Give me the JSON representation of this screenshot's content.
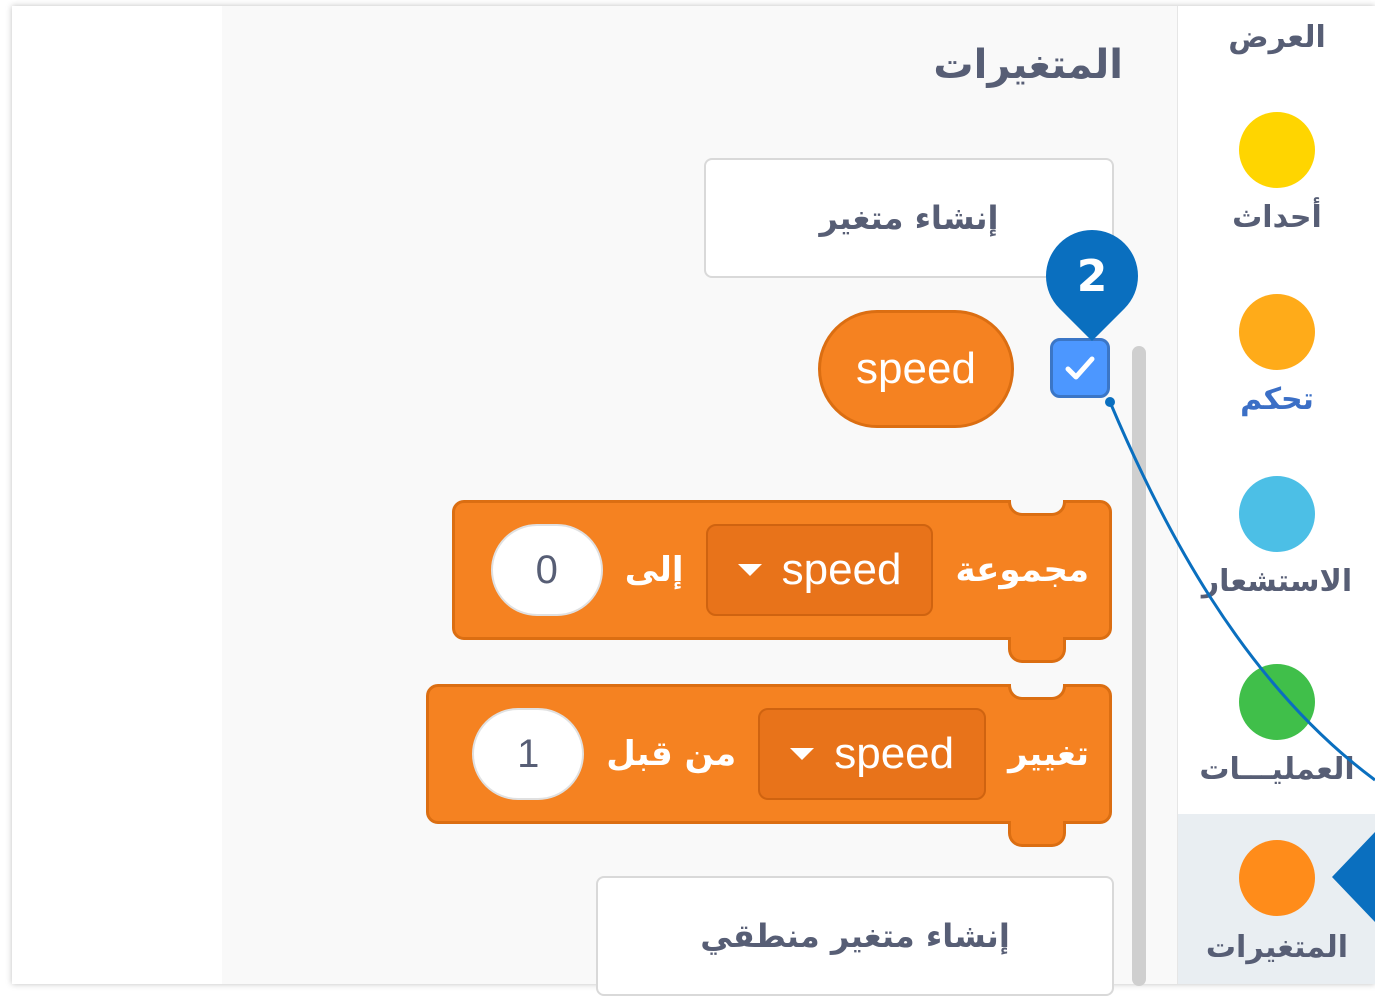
{
  "palette": {
    "section_title": "المتغيرات",
    "make_variable_label": "إنشاء متغير",
    "make_boolean_label": "إنشاء متغير منطقي",
    "variable_reporter": {
      "name": "speed",
      "show_checked": true
    },
    "set_block": {
      "label": "مجموعة",
      "dropdown": "speed",
      "to_label": "إلى",
      "value": "0"
    },
    "change_block": {
      "label": "تغيير",
      "dropdown": "speed",
      "by_label": "من قبل",
      "value": "1"
    }
  },
  "categories": {
    "top_label": "العرض",
    "items": [
      {
        "label": "أحداث",
        "color": "#ffd500"
      },
      {
        "label": "تحكم",
        "color": "#ffab19"
      },
      {
        "label": "الاستشعار",
        "color": "#4cbfe6"
      },
      {
        "label": "العمليـــات",
        "color": "#40bf4a"
      },
      {
        "label": "المتغيرات",
        "color": "#ff8c1a",
        "selected": true
      }
    ]
  },
  "callout": {
    "number": "2",
    "color": "#0a6fbf"
  }
}
